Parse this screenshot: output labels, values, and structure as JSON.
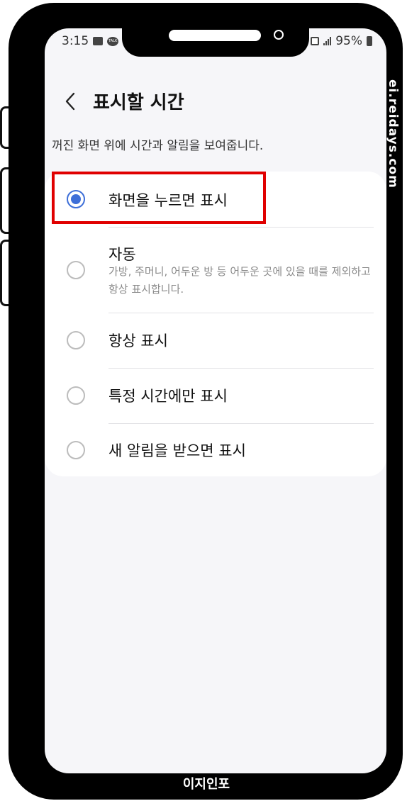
{
  "status_bar": {
    "time": "3:15",
    "talk_label": "TALK",
    "battery": "95%",
    "icons": [
      "gallery-icon",
      "kakaotalk-icon",
      "nfc-icon",
      "signal-icon",
      "battery-icon"
    ]
  },
  "header": {
    "back_icon": "chevron-left-icon",
    "title": "표시할 시간"
  },
  "subtitle": "꺼진 화면 위에 시간과 알림을 보여줍니다.",
  "options": [
    {
      "label": "화면을 누르면 표시",
      "selected": true
    },
    {
      "label": "자동",
      "description": "가방, 주머니, 어두운 방 등 어두운 곳에 있을 때를 제외하고 항상 표시합니다.",
      "selected": false
    },
    {
      "label": "항상 표시",
      "selected": false
    },
    {
      "label": "특정 시간에만 표시",
      "selected": false
    },
    {
      "label": "새 알림을 받으면 표시",
      "selected": false
    }
  ],
  "watermarks": {
    "side": "ei.reidays.com",
    "bottom": "이지인포"
  },
  "colors": {
    "accent": "#3e6fd8",
    "highlight": "#e00000",
    "background": "#f6f6f9"
  }
}
